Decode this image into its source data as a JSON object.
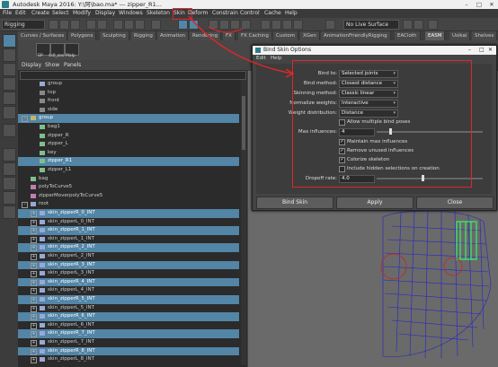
{
  "window": {
    "title": "Autodesk Maya 2016: Y:\\阿\\bao.ma*   ---   zipper_R1..."
  },
  "menubar": {
    "items": [
      "File",
      "Edit",
      "Create",
      "Select",
      "Modify",
      "Display",
      "Windows",
      "Skeleton",
      "Skin",
      "Deform",
      "Constrain",
      "Control",
      "Cache",
      "Help"
    ]
  },
  "statusline": {
    "menuset": "Rigging",
    "live_surface": "No Live Surface"
  },
  "shelf": {
    "tabs": [
      "Curves / Surfaces",
      "Polygons",
      "Sculpting",
      "Rigging",
      "Animation",
      "Rendering",
      "FX",
      "FX Caching",
      "Custom",
      "XGen",
      "AnimationFriendlyRigging",
      "EACloth",
      "EASM",
      "Usikai",
      "Shelves"
    ],
    "active_tab": "EASM",
    "items": [
      {
        "label": "SP"
      },
      {
        "label": "ss0_zoo"
      },
      {
        "label": "Malp"
      }
    ]
  },
  "outliner": {
    "menu": [
      "Display",
      "Show",
      "Panels"
    ],
    "rows": [
      {
        "label": "group",
        "indent": 2,
        "icon": "joint",
        "selected": false,
        "exp": ""
      },
      {
        "label": "top",
        "indent": 2,
        "icon": "camera",
        "selected": false,
        "exp": ""
      },
      {
        "label": "front",
        "indent": 2,
        "icon": "camera",
        "selected": false,
        "exp": ""
      },
      {
        "label": "side",
        "indent": 2,
        "icon": "camera",
        "selected": false,
        "exp": ""
      },
      {
        "label": "group",
        "indent": 1,
        "icon": "group",
        "selected": true,
        "exp": "-"
      },
      {
        "label": "bag1",
        "indent": 2,
        "icon": "curve",
        "selected": false,
        "exp": ""
      },
      {
        "label": "zipper_R",
        "indent": 2,
        "icon": "curve",
        "selected": false,
        "exp": ""
      },
      {
        "label": "zipper_L",
        "indent": 2,
        "icon": "curve",
        "selected": false,
        "exp": ""
      },
      {
        "label": "key",
        "indent": 2,
        "icon": "curve",
        "selected": false,
        "exp": ""
      },
      {
        "label": "zipper_R1",
        "indent": 2,
        "icon": "curve",
        "selected": true,
        "exp": ""
      },
      {
        "label": "zipper_L1",
        "indent": 2,
        "icon": "curve",
        "selected": false,
        "exp": ""
      },
      {
        "label": "bag",
        "indent": 1,
        "icon": "curve",
        "selected": false,
        "exp": ""
      },
      {
        "label": "polyToCurve5",
        "indent": 1,
        "icon": "node",
        "selected": false,
        "exp": ""
      },
      {
        "label": "zipperMoverpolyToCurve5",
        "indent": 1,
        "icon": "node",
        "selected": false,
        "exp": ""
      },
      {
        "label": "root",
        "indent": 1,
        "icon": "joint",
        "selected": false,
        "exp": "-"
      },
      {
        "label": "skin_zipperR_0_INT",
        "indent": 2,
        "icon": "joint",
        "selected": true,
        "exp": "+"
      },
      {
        "label": "skin_zipperL_0_INT",
        "indent": 2,
        "icon": "joint",
        "selected": false,
        "exp": "+"
      },
      {
        "label": "skin_zipperR_1_INT",
        "indent": 2,
        "icon": "joint",
        "selected": true,
        "exp": "+"
      },
      {
        "label": "skin_zipperL_1_INT",
        "indent": 2,
        "icon": "joint",
        "selected": false,
        "exp": "+"
      },
      {
        "label": "skin_zipperR_2_INT",
        "indent": 2,
        "icon": "joint",
        "selected": true,
        "exp": "+"
      },
      {
        "label": "skin_zipperL_2_INT",
        "indent": 2,
        "icon": "joint",
        "selected": false,
        "exp": "+"
      },
      {
        "label": "skin_zipperR_3_INT",
        "indent": 2,
        "icon": "joint",
        "selected": true,
        "exp": "+"
      },
      {
        "label": "skin_zipperL_3_INT",
        "indent": 2,
        "icon": "joint",
        "selected": false,
        "exp": "+"
      },
      {
        "label": "skin_zipperR_4_INT",
        "indent": 2,
        "icon": "joint",
        "selected": true,
        "exp": "+"
      },
      {
        "label": "skin_zipperL_4_INT",
        "indent": 2,
        "icon": "joint",
        "selected": false,
        "exp": "+"
      },
      {
        "label": "skin_zipperR_5_INT",
        "indent": 2,
        "icon": "joint",
        "selected": true,
        "exp": "+"
      },
      {
        "label": "skin_zipperL_5_INT",
        "indent": 2,
        "icon": "joint",
        "selected": false,
        "exp": "+"
      },
      {
        "label": "skin_zipperR_6_INT",
        "indent": 2,
        "icon": "joint",
        "selected": true,
        "exp": "+"
      },
      {
        "label": "skin_zipperL_6_INT",
        "indent": 2,
        "icon": "joint",
        "selected": false,
        "exp": "+"
      },
      {
        "label": "skin_zipperR_7_INT",
        "indent": 2,
        "icon": "joint",
        "selected": true,
        "exp": "+"
      },
      {
        "label": "skin_zipperL_7_INT",
        "indent": 2,
        "icon": "joint",
        "selected": false,
        "exp": "+"
      },
      {
        "label": "skin_zipperR_8_INT",
        "indent": 2,
        "icon": "joint",
        "selected": true,
        "exp": "+"
      },
      {
        "label": "skin_zipperL_8_INT",
        "indent": 2,
        "icon": "joint",
        "selected": false,
        "exp": "+"
      }
    ]
  },
  "dialog": {
    "title": "Bind Skin Options",
    "menu": [
      "Edit",
      "Help"
    ],
    "fields": {
      "bind_to": {
        "label": "Bind to:",
        "value": "Selected joints"
      },
      "bind_method": {
        "label": "Bind method:",
        "value": "Closest distance"
      },
      "skinning_method": {
        "label": "Skinning method:",
        "value": "Classic linear"
      },
      "normalize_weights": {
        "label": "Normalize weights:",
        "value": "Interactive"
      },
      "weight_distribution": {
        "label": "Weight distribution:",
        "value": "Distance"
      },
      "allow_multiple": {
        "label": "Allow multiple bind poses",
        "checked": false
      },
      "max_influences": {
        "label": "Max influences:",
        "value": "4",
        "fraction": 0.12
      },
      "maintain_max": {
        "label": "Maintain max influences",
        "checked": true
      },
      "remove_unused": {
        "label": "Remove unused influences",
        "checked": true
      },
      "colorize": {
        "label": "Colorize skeleton",
        "checked": true
      },
      "include_hidden": {
        "label": "Include hidden selections on creation",
        "checked": false
      },
      "dropoff_rate": {
        "label": "Dropoff rate:",
        "value": "4.0",
        "fraction": 0.42
      }
    },
    "buttons": {
      "bind": "Bind Skin",
      "apply": "Apply",
      "close": "Close"
    }
  },
  "colors": {
    "selection": "#5285a6",
    "annotation": "#e0262a",
    "wire": "#2424c8",
    "joint_green": "#3ae86a"
  }
}
